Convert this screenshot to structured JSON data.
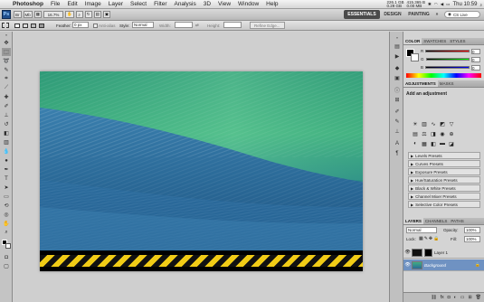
{
  "menubar": {
    "app_name": "Photoshop",
    "items": [
      "File",
      "Edit",
      "Image",
      "Layer",
      "Select",
      "Filter",
      "Analysis",
      "3D",
      "View",
      "Window",
      "Help"
    ],
    "status": {
      "meter_top": "226.1 GB",
      "meter_bottom": "0.29 GB",
      "meter2_top": "415.365 B",
      "meter2_bottom": "0.00 MB",
      "clock": "Thu 10:59"
    }
  },
  "appbar": {
    "app_icon": "Ps",
    "zoom": "16.7%",
    "workspaces": [
      "ESSENTIALS",
      "DESIGN",
      "PAINTING",
      "»"
    ],
    "search_label": "CS Live"
  },
  "options_bar": {
    "feather_label": "Feather:",
    "feather_value": "0 px",
    "anti_alias_label": "Anti-alias",
    "style_label": "Style:",
    "style_value": "Normal",
    "width_label": "Width:",
    "height_label": "Height:",
    "refine_edge_label": "Refine Edge..."
  },
  "color_panel": {
    "tabs": [
      "COLOR",
      "SWATCHES",
      "STYLES"
    ],
    "channels": [
      {
        "name": "R",
        "value": "0"
      },
      {
        "name": "G",
        "value": "0"
      },
      {
        "name": "B",
        "value": "0"
      }
    ]
  },
  "adjustments_panel": {
    "tabs": [
      "ADJUSTMENTS",
      "MASKS"
    ],
    "subtitle": "Add an adjustment",
    "presets": [
      "Levels Presets",
      "Curves Presets",
      "Exposure Presets",
      "Hue/Saturation Presets",
      "Black & White Presets",
      "Channel Mixer Presets",
      "Selective Color Presets"
    ]
  },
  "layers_panel": {
    "tabs": [
      "LAYERS",
      "CHANNELS",
      "PATHS"
    ],
    "blend_mode": "Normal",
    "opacity_label": "Opacity:",
    "opacity_value": "100%",
    "lock_label": "Lock:",
    "fill_label": "Fill:",
    "fill_value": "100%",
    "layers": [
      {
        "name": "Layer 1",
        "active": false
      },
      {
        "name": "Background",
        "active": true
      }
    ]
  },
  "colors": {
    "accent": "#1f4e8c",
    "stripe_yellow": "#f1cc16",
    "stripe_black": "#111111"
  }
}
